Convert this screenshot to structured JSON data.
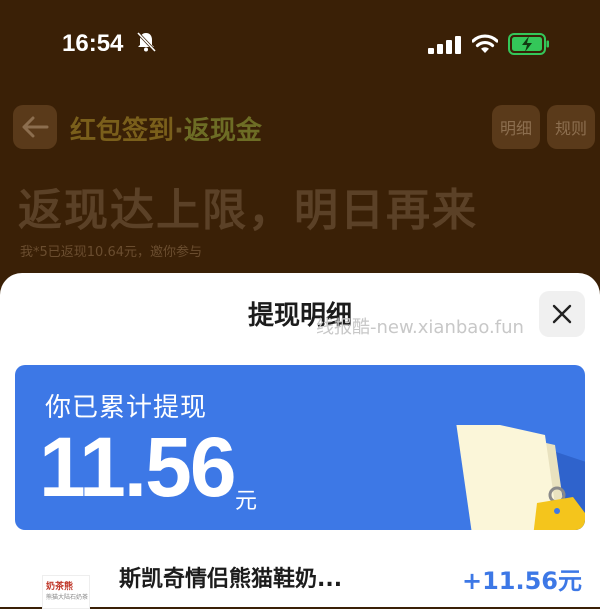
{
  "status_bar": {
    "time": "16:54"
  },
  "header": {
    "title_part1": "红包签到",
    "title_dot": "·",
    "title_part2": "返现金",
    "detail_label": "明细",
    "rules_label": "规则"
  },
  "banner": {
    "title": "返现达上限，明日再来",
    "subtitle": "我*5已返现10.64元，邀你参与"
  },
  "sheet": {
    "title": "提现明细",
    "watermark": "线报酷-new.xianbao.fun"
  },
  "summary_card": {
    "label": "你已累计提现",
    "amount": "11.56",
    "unit": "元",
    "tag_symbol": "%"
  },
  "records": [
    {
      "thumb_title": "奶茶熊",
      "thumb_caption": "熊猫大陆石奶茶",
      "name": "斯凯奇情侣熊猫鞋奶...",
      "amount": "+11.56元"
    }
  ],
  "colors": {
    "accent_blue": "#3d78e6",
    "overlay_bg": "#3a2006"
  }
}
